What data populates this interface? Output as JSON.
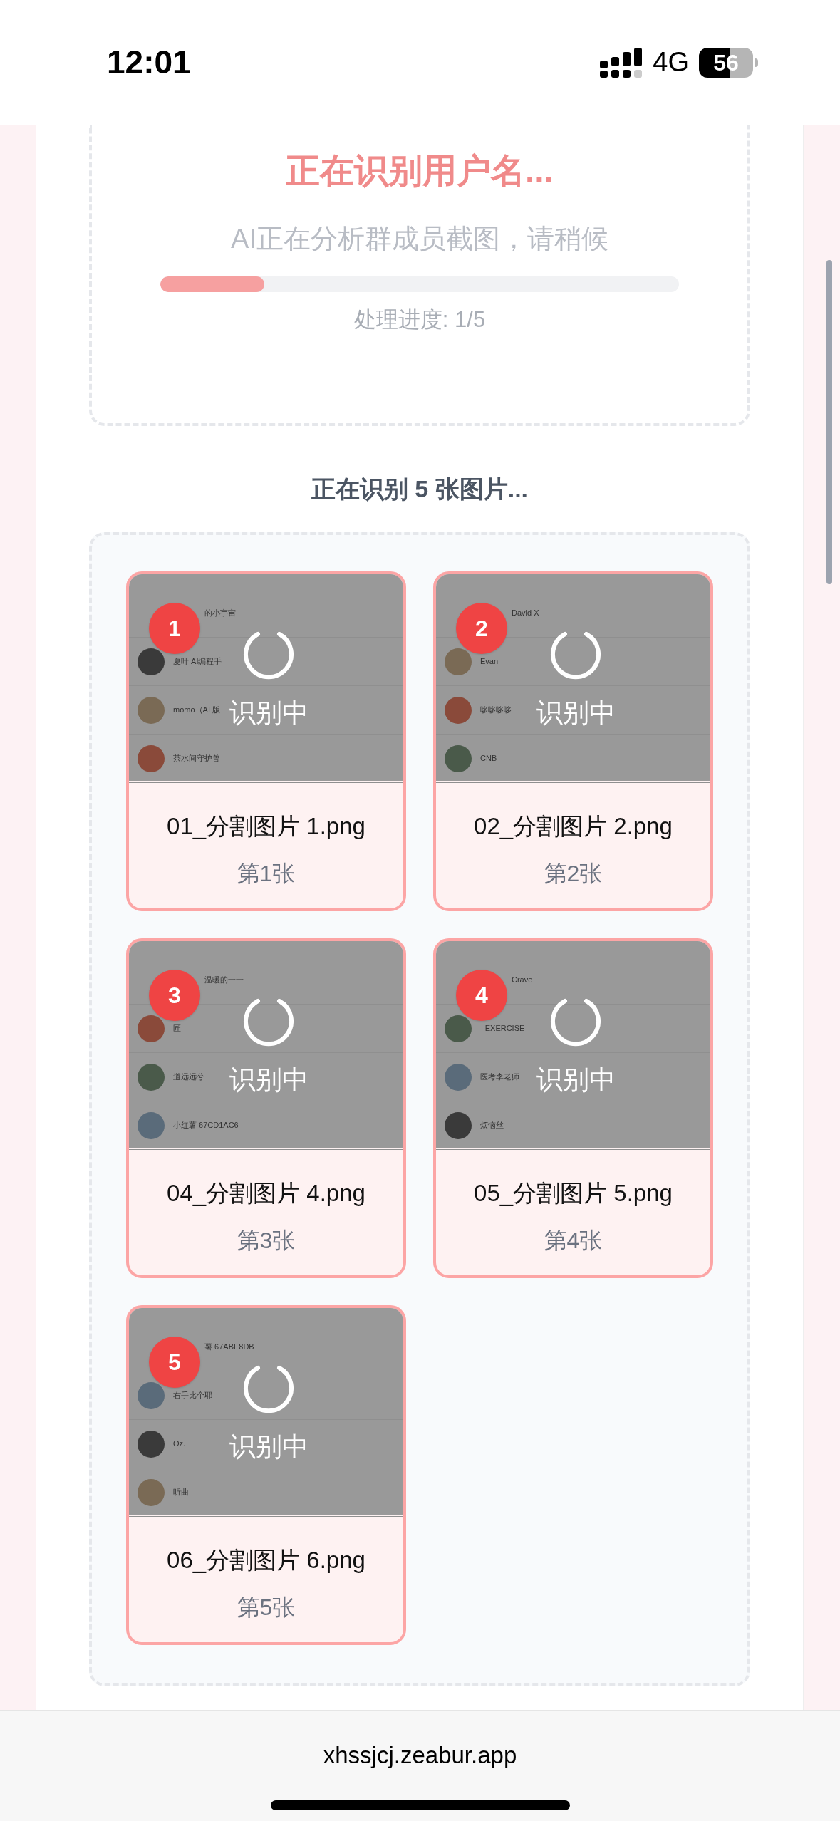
{
  "status_bar": {
    "time": "12:01",
    "network": "4G",
    "battery": "56"
  },
  "progress_card": {
    "title": "正在识别用户名...",
    "subtitle": "AI正在分析群成员截图，请稍候",
    "level": 0.2,
    "progress_text": "处理进度: 1/5"
  },
  "images_heading": "正在识别 5 张图片...",
  "images": [
    {
      "badge": "1",
      "overlay_text": "识别中",
      "filename": "01_分割图片 1.png",
      "caption": "第1张",
      "rows": [
        "的小宇宙",
        "夏叶 AI编程手",
        "momo（AI 版",
        "茶水间守护兽"
      ]
    },
    {
      "badge": "2",
      "overlay_text": "识别中",
      "filename": "02_分割图片 2.png",
      "caption": "第2张",
      "rows": [
        "David X",
        "Evan",
        "哆哆哆哆",
        "CNB"
      ]
    },
    {
      "badge": "3",
      "overlay_text": "识别中",
      "filename": "04_分割图片 4.png",
      "caption": "第3张",
      "rows": [
        "温暖的一一",
        "匠",
        "道远远兮",
        "小红薯 67CD1AC6"
      ]
    },
    {
      "badge": "4",
      "overlay_text": "识别中",
      "filename": "05_分割图片 5.png",
      "caption": "第4张",
      "rows": [
        "Crave",
        "- EXERCISE -",
        "医考李老师",
        "烦恼丝"
      ]
    },
    {
      "badge": "5",
      "overlay_text": "识别中",
      "filename": "06_分割图片 6.png",
      "caption": "第5张",
      "rows": [
        "薯 67ABE8DB",
        "右手比个耶",
        "Oz.",
        "听曲"
      ]
    }
  ],
  "address_bar": {
    "url": "xhssjcj.zeabur.app"
  }
}
